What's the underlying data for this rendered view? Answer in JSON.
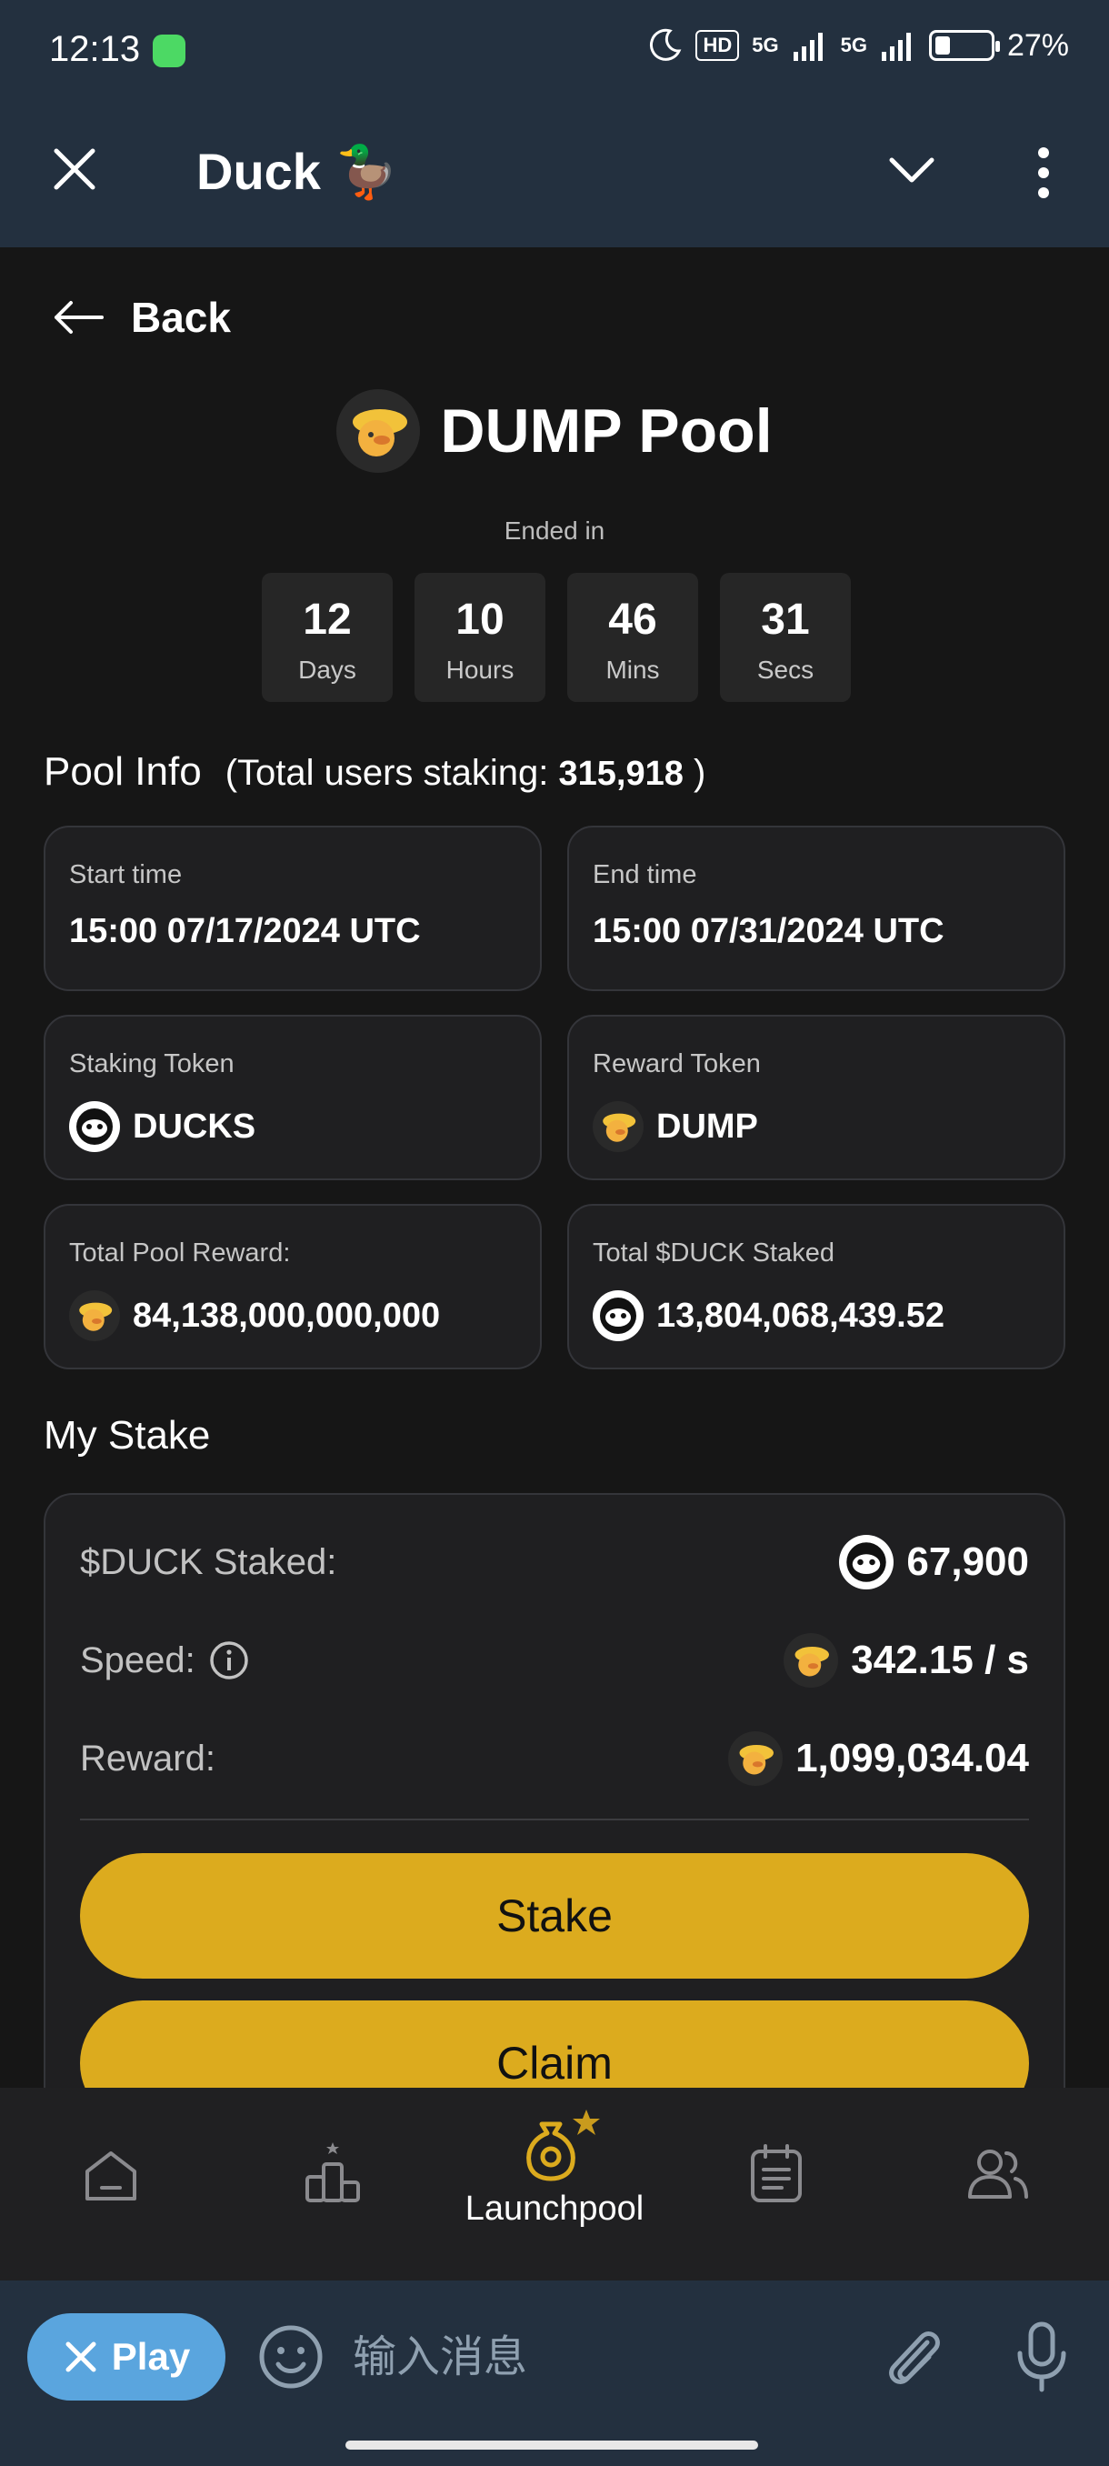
{
  "status_bar": {
    "time": "12:13",
    "hd": "HD",
    "net1": "5G",
    "net2": "5G",
    "battery": "27%",
    "battery_level": 0.27
  },
  "header": {
    "title": "Duck 🦆"
  },
  "back_label": "Back",
  "pool": {
    "title": "DUMP Pool",
    "ended_label": "Ended in",
    "countdown": [
      {
        "value": "12",
        "unit": "Days"
      },
      {
        "value": "10",
        "unit": "Hours"
      },
      {
        "value": "46",
        "unit": "Mins"
      },
      {
        "value": "31",
        "unit": "Secs"
      }
    ]
  },
  "pool_info": {
    "title": "Pool Info",
    "users_prefix": "(Total users staking:",
    "users_count": "315,918",
    "users_suffix": ")",
    "cards": {
      "start": {
        "label": "Start time",
        "value": "15:00 07/17/2024 UTC"
      },
      "end": {
        "label": "End time",
        "value": "15:00 07/31/2024 UTC"
      },
      "staking_token": {
        "label": "Staking Token",
        "value": "DUCKS"
      },
      "reward_token": {
        "label": "Reward Token",
        "value": "DUMP"
      },
      "total_reward": {
        "label": "Total Pool Reward:",
        "value": "84,138,000,000,000"
      },
      "total_staked": {
        "label": "Total $DUCK Staked",
        "value": "13,804,068,439.52"
      }
    }
  },
  "my_stake": {
    "title": "My Stake",
    "staked_label": "$DUCK Staked:",
    "staked_value": "67,900",
    "speed_label": "Speed:",
    "speed_value": "342.15 / s",
    "reward_label": "Reward:",
    "reward_value": "1,099,034.04",
    "stake_button": "Stake",
    "claim_button": "Claim"
  },
  "bottom_nav": {
    "active_label": "Launchpool"
  },
  "input_bar": {
    "play_label": "Play",
    "placeholder": "输入消息"
  },
  "colors": {
    "accent": "#dcab1e",
    "telegram_bar": "#23303f",
    "background": "#161616",
    "play_button": "#5aa5de"
  }
}
